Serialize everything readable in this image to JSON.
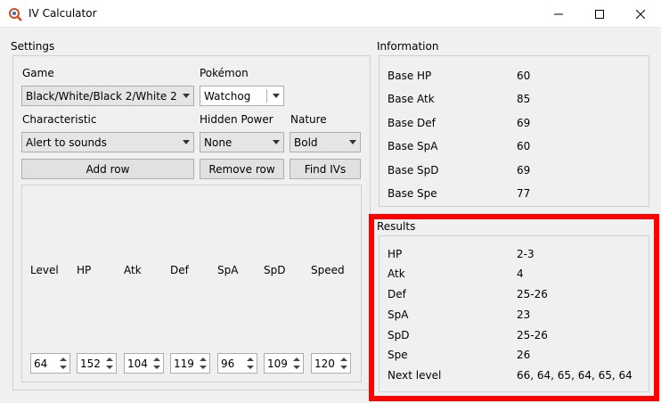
{
  "window": {
    "title": "IV Calculator"
  },
  "colors": {
    "highlight": "#ff0000"
  },
  "settings": {
    "title": "Settings",
    "game_label": "Game",
    "game_value": "Black/White/Black 2/White 2",
    "pokemon_label": "Pokémon",
    "pokemon_value": "Watchog",
    "characteristic_label": "Characteristic",
    "characteristic_value": "Alert to sounds",
    "hidden_power_label": "Hidden Power",
    "hidden_power_value": "None",
    "nature_label": "Nature",
    "nature_value": "Bold",
    "add_row": "Add row",
    "remove_row": "Remove row",
    "find_ivs": "Find IVs",
    "columns": [
      "Level",
      "HP",
      "Atk",
      "Def",
      "SpA",
      "SpD",
      "Speed"
    ],
    "row_values": [
      "64",
      "152",
      "104",
      "119",
      "96",
      "109",
      "120"
    ]
  },
  "information": {
    "title": "Information",
    "rows": [
      {
        "label": "Base HP",
        "value": "60"
      },
      {
        "label": "Base Atk",
        "value": "85"
      },
      {
        "label": "Base Def",
        "value": "69"
      },
      {
        "label": "Base SpA",
        "value": "60"
      },
      {
        "label": "Base SpD",
        "value": "69"
      },
      {
        "label": "Base Spe",
        "value": "77"
      }
    ]
  },
  "results": {
    "title": "Results",
    "rows": [
      {
        "label": "HP",
        "value": "2-3"
      },
      {
        "label": "Atk",
        "value": "4"
      },
      {
        "label": "Def",
        "value": "25-26"
      },
      {
        "label": "SpA",
        "value": "23"
      },
      {
        "label": "SpD",
        "value": "25-26"
      },
      {
        "label": "Spe",
        "value": "26"
      },
      {
        "label": "Next level",
        "value": "66, 64, 65, 64, 65, 64"
      }
    ]
  }
}
